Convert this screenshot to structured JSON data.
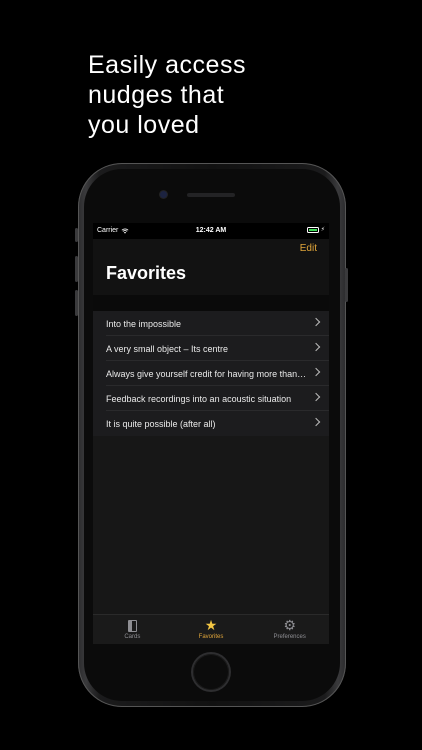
{
  "headline": [
    "Easily access",
    "nudges that",
    "you loved"
  ],
  "status_bar": {
    "carrier": "Carrier",
    "time": "12:42 AM"
  },
  "nav": {
    "edit_label": "Edit",
    "title": "Favorites"
  },
  "favorites": [
    {
      "label": "Into the impossible"
    },
    {
      "label": "A very small object – Its centre"
    },
    {
      "label": "Always give yourself credit for having more than personality"
    },
    {
      "label": "Feedback recordings into an acoustic situation"
    },
    {
      "label": "It is quite possible (after all)"
    }
  ],
  "tabs": [
    {
      "label": "Cards",
      "icon": "cards-icon"
    },
    {
      "label": "Favorites",
      "icon": "star-icon",
      "active": true
    },
    {
      "label": "Preferences",
      "icon": "gear-icon"
    }
  ],
  "colors": {
    "accent": "#e0a53a",
    "star": "#f3c643",
    "battery": "#3ddc56"
  }
}
